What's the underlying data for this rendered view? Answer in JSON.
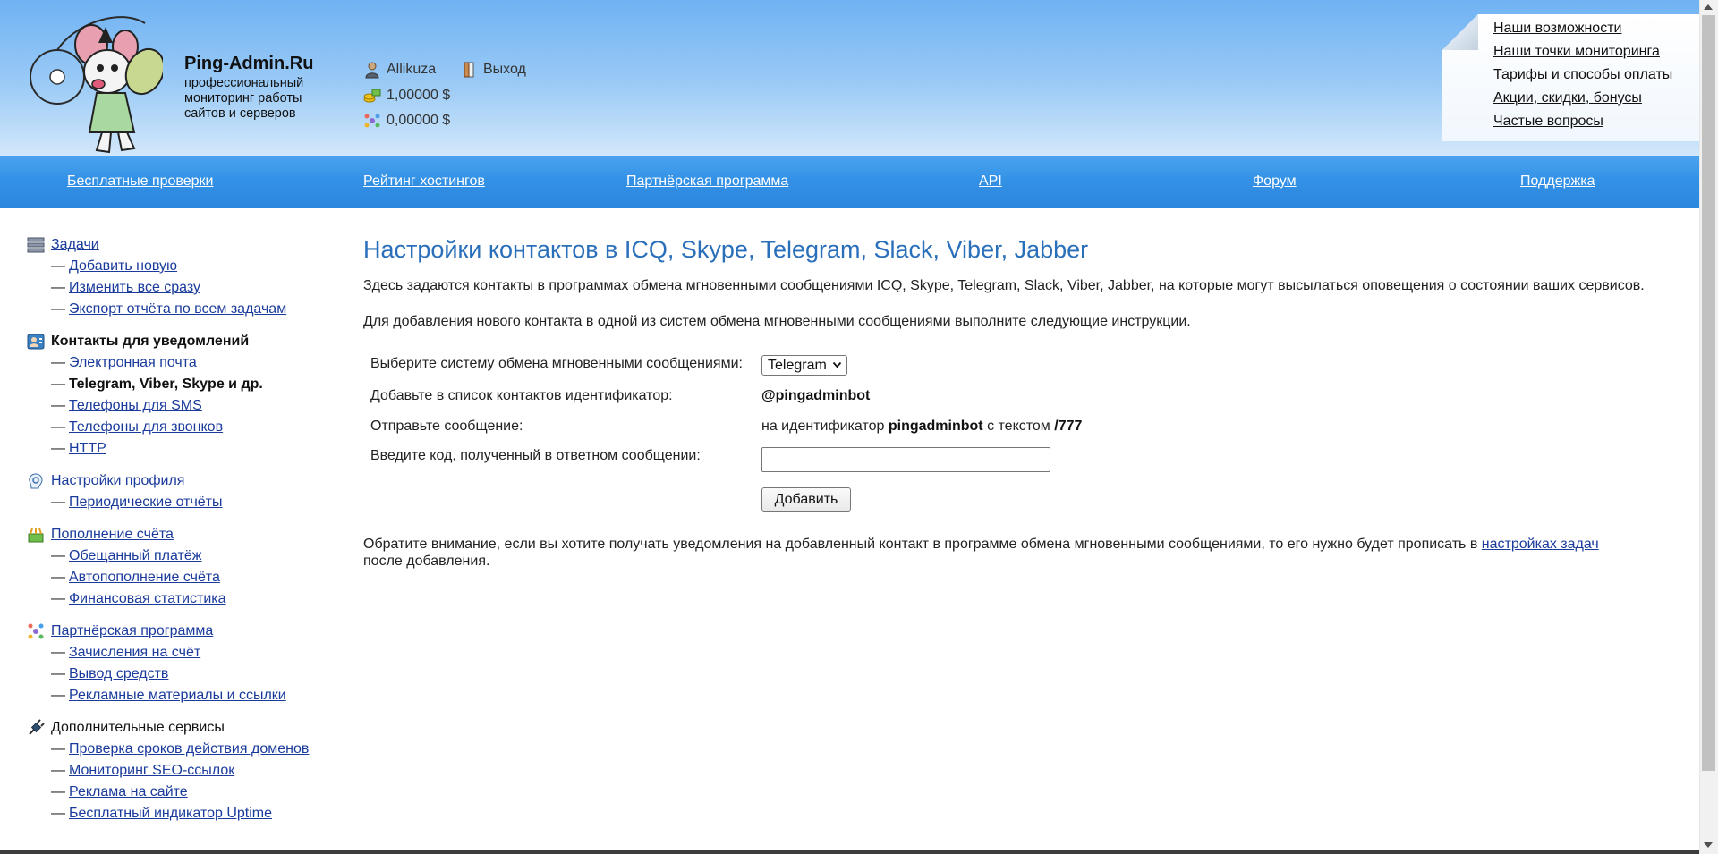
{
  "header": {
    "brand_name": "Ping-Admin.Ru",
    "brand_tagline": "профессиональный мониторинг работы сайтов и серверов",
    "username": "Allikuza",
    "logout_label": "Выход",
    "balance_main": "1,00000 $",
    "balance_partner": "0,00000 $",
    "note_links": [
      "Наши возможности",
      "Наши точки мониторинга",
      "Тарифы и способы оплаты",
      "Акции, скидки, бонусы",
      "Частые вопросы"
    ]
  },
  "nav": {
    "free_checks": "Бесплатные проверки",
    "hosting_rating": "Рейтинг хостингов",
    "partner_program": "Партнёрская программа",
    "api": "API",
    "forum": "Форум",
    "support": "Поддержка"
  },
  "sidebar": {
    "dash": "—",
    "groups": [
      {
        "title": "Задачи",
        "icon": "server-icon",
        "items": [
          "Добавить новую",
          "Изменить все сразу",
          "Экспорт отчёта по всем задачам"
        ]
      },
      {
        "title": "Контакты для уведомлений",
        "icon": "contacts-icon",
        "items": [
          "Электронная почта",
          "Telegram, Viber, Skype и др.",
          "Телефоны для SMS",
          "Телефоны для звонков",
          "HTTP"
        ]
      },
      {
        "title": "Настройки профиля",
        "icon": "profile-settings-icon",
        "items": [
          "Периодические отчёты"
        ]
      },
      {
        "title": "Пополнение счёта",
        "icon": "wallet-icon",
        "items": [
          "Обещанный платёж",
          "Автопополнение счёта",
          "Финансовая статистика"
        ]
      },
      {
        "title": "Партнёрская программа",
        "icon": "partner-icon",
        "items": [
          "Зачисления на счёт",
          "Вывод средств",
          "Рекламные материалы и ссылки"
        ]
      },
      {
        "title": "Дополнительные сервисы",
        "icon": "plug-icon",
        "items": [
          "Проверка сроков действия доменов",
          "Мониторинг SEO-ссылок",
          "Реклама на сайте",
          "Бесплатный индикатор Uptime"
        ]
      }
    ]
  },
  "main": {
    "title": "Настройки контактов в ICQ, Skype, Telegram, Slack, Viber, Jabber",
    "intro1": "Здесь задаются контакты в программах обмена мгновенными сообщениями ICQ, Skype, Telegram, Slack, Viber, Jabber, на которые могут высылаться оповещения о состоянии ваших сервисов.",
    "intro2": "Для добавления нового контакта в одной из систем обмена мгновенными сообщениями выполните следующие инструкции.",
    "form": {
      "label_system": "Выберите систему обмена мгновенными сообщениями:",
      "selected_system": "Telegram",
      "label_add": "Добавьте в список контактов идентификатор:",
      "bot_id": "@pingadminbot",
      "label_send": "Отправьте сообщение:",
      "send_prefix": "на идентификатор",
      "send_target": "pingadminbot",
      "send_middle": "с текстом",
      "send_code": "/777",
      "label_code": "Введите код, полученный в ответном сообщении:",
      "code_value": "",
      "add_button": "Добавить"
    },
    "notice_before": "Обратите внимание, если вы хотите получать уведомления на добавленный контакт в программе обмена мгновенными сообщениями, то его нужно будет прописать в",
    "notice_link": "настройках задач",
    "notice_after": "после добавления."
  },
  "colors": {
    "title_blue": "#2a6fba",
    "nav_blue": "#3391e6",
    "link": "#1a3b9c"
  }
}
